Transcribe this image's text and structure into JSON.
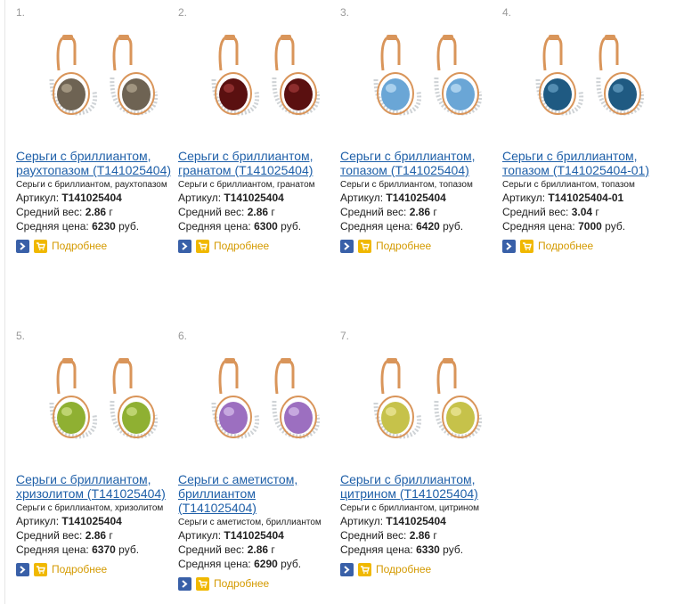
{
  "products": [
    {
      "number": "1.",
      "title_line1": "Серьги с бриллиантом,",
      "title_line2": "раухтопазом (Т141025404)",
      "subtitle": "Серьги с бриллиантом, раухтопазом",
      "article_label": "Артикул:",
      "article": "Т141025404",
      "weight_label": "Средний вес:",
      "weight": "2.86",
      "weight_unit": "г",
      "price_label": "Средняя цена:",
      "price": "6230",
      "price_unit": "руб.",
      "more_label": "Подробнее",
      "gem_color": "#6e6353",
      "gem_highlight": "#b7ab94"
    },
    {
      "number": "2.",
      "title_line1": "Серьги с бриллиантом,",
      "title_line2": "гранатом (Т141025404)",
      "subtitle": "Серьги с бриллиантом, гранатом",
      "article_label": "Артикул:",
      "article": "Т141025404",
      "weight_label": "Средний вес:",
      "weight": "2.86",
      "weight_unit": "г",
      "price_label": "Средняя цена:",
      "price": "6300",
      "price_unit": "руб.",
      "more_label": "Подробнее",
      "gem_color": "#5a1010",
      "gem_highlight": "#a33a3a"
    },
    {
      "number": "3.",
      "title_line1": "Серьги с бриллиантом,",
      "title_line2": "топазом (Т141025404)",
      "subtitle": "Серьги с бриллиантом, топазом",
      "article_label": "Артикул:",
      "article": "Т141025404",
      "weight_label": "Средний вес:",
      "weight": "2.86",
      "weight_unit": "г",
      "price_label": "Средняя цена:",
      "price": "6420",
      "price_unit": "руб.",
      "more_label": "Подробнее",
      "gem_color": "#6aa6d6",
      "gem_highlight": "#c4e2f6"
    },
    {
      "number": "4.",
      "title_line1": "Серьги с бриллиантом,",
      "title_line2": "топазом (Т141025404-01)",
      "subtitle": "Серьги с бриллиантом, топазом",
      "article_label": "Артикул:",
      "article": "Т141025404-01",
      "weight_label": "Средний вес:",
      "weight": "3.04",
      "weight_unit": "г",
      "price_label": "Средняя цена:",
      "price": "7000",
      "price_unit": "руб.",
      "more_label": "Подробнее",
      "gem_color": "#1f5a82",
      "gem_highlight": "#6aa2c6"
    },
    {
      "number": "5.",
      "title_line1": "Серьги с бриллиантом,",
      "title_line2": "хризолитом (Т141025404)",
      "subtitle": "Серьги с бриллиантом, хризолитом",
      "article_label": "Артикул:",
      "article": "Т141025404",
      "weight_label": "Средний вес:",
      "weight": "2.86",
      "weight_unit": "г",
      "price_label": "Средняя цена:",
      "price": "6370",
      "price_unit": "руб.",
      "more_label": "Подробнее",
      "gem_color": "#8fb032",
      "gem_highlight": "#d1e48a"
    },
    {
      "number": "6.",
      "title_line1": "Серьги с аметистом,",
      "title_line2": "бриллиантом",
      "title_line3": "(Т141025404)",
      "subtitle": "Серьги с аметистом, бриллиантом",
      "article_label": "Артикул:",
      "article": "Т141025404",
      "weight_label": "Средний вес:",
      "weight": "2.86",
      "weight_unit": "г",
      "price_label": "Средняя цена:",
      "price": "6290",
      "price_unit": "руб.",
      "more_label": "Подробнее",
      "gem_color": "#9c6fc0",
      "gem_highlight": "#d9c1ec"
    },
    {
      "number": "7.",
      "title_line1": "Серьги с бриллиантом,",
      "title_line2": "цитрином (Т141025404)",
      "subtitle": "Серьги с бриллиантом, цитрином",
      "article_label": "Артикул:",
      "article": "Т141025404",
      "weight_label": "Средний вес:",
      "weight": "2.86",
      "weight_unit": "г",
      "price_label": "Средняя цена:",
      "price": "6330",
      "price_unit": "руб.",
      "more_label": "Подробнее",
      "gem_color": "#c6c24a",
      "gem_highlight": "#efeaa0"
    }
  ],
  "icons": {
    "arrow": "arrow-right-icon",
    "cart": "cart-icon"
  },
  "colors": {
    "link": "#1e5fa8",
    "more_link": "#d49a00",
    "arrow_button": "#3960a8",
    "cart_button": "#f0b800",
    "gold": "#d9955a"
  }
}
